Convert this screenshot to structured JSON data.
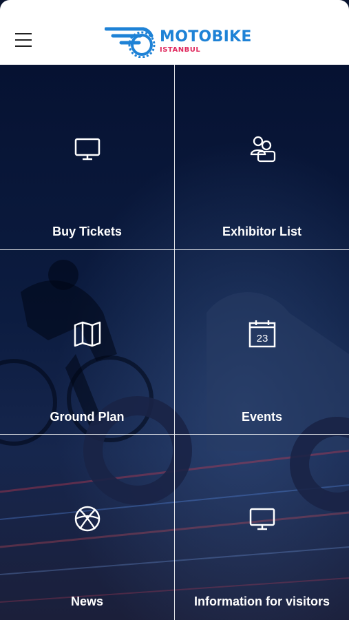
{
  "header": {
    "menu_icon": "hamburger-menu-icon",
    "logo": {
      "name": "MOTOBIKE",
      "subtitle": "ISTANBUL",
      "primary_color": "#1e82d6",
      "accent_color": "#e0275c"
    }
  },
  "tiles": [
    {
      "label": "Buy Tickets",
      "icon": "monitor-icon"
    },
    {
      "label": "Exhibitor List",
      "icon": "people-icon"
    },
    {
      "label": "Ground Plan",
      "icon": "map-icon"
    },
    {
      "label": "Events",
      "icon": "calendar-icon",
      "icon_text": "23"
    },
    {
      "label": "News",
      "icon": "globe-icon"
    },
    {
      "label": "Information for visitors",
      "icon": "monitor-icon"
    }
  ],
  "colors": {
    "background": "#0a1530",
    "grid_line": "#ffffff",
    "text": "#ffffff"
  }
}
